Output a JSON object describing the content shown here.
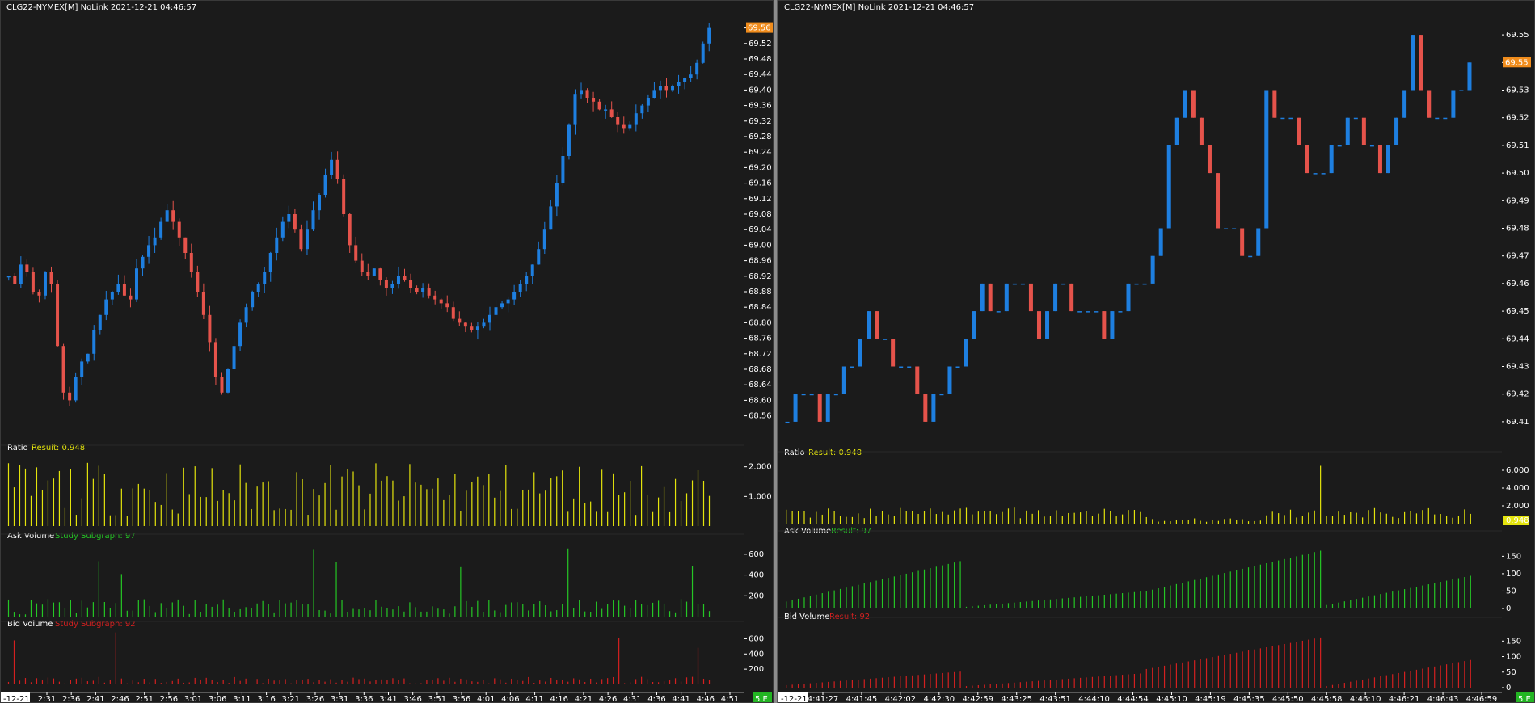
{
  "colors": {
    "background": "#1b1b1b",
    "up_bar": "#1e7fe0",
    "down_bar": "#e5534b",
    "ratio": "#e4e40c",
    "ask": "#25c725",
    "bid": "#d42020",
    "last_price_bg": "#f08c1c",
    "separator": "#9a9a9a",
    "accent_green": "#23b523"
  },
  "left": {
    "title": "CLG22-NYMEX[M] NoLink 2021-12-21 04:46:57",
    "last_price_label": "69.56",
    "studies": {
      "ratio": {
        "name": "Ratio",
        "result": "Result: 0.948"
      },
      "ask": {
        "name": "Ask Volume",
        "result": "Study Subgraph: 97"
      },
      "bid": {
        "name": "Bid Volume",
        "result": "Study Subgraph: 92"
      }
    },
    "date_label": "-12-21",
    "corner_badge": "5 E"
  },
  "right": {
    "title": "CLG22-NYMEX[M] NoLink 2021-12-21 04:46:57",
    "last_price_label": "69.55",
    "ratio_last_label": "0.948",
    "studies": {
      "ratio": {
        "name": "Ratio",
        "result": "Result: 0.948"
      },
      "ask": {
        "name": "Ask Volume",
        "result": "Result: 97"
      },
      "bid": {
        "name": "Bid Volume",
        "result": "Result: 92"
      }
    },
    "date_label": "-12-21",
    "corner_badge": "5 E"
  },
  "chart_data": [
    {
      "type": "candlestick",
      "title": "CLG22-NYMEX[M] NoLink 2021-12-21 04:46:57",
      "ylim": [
        68.53,
        69.58
      ],
      "y_ticks": [
        "69.56",
        "69.52",
        "69.48",
        "69.44",
        "69.40",
        "69.36",
        "69.32",
        "69.28",
        "69.24",
        "69.20",
        "69.16",
        "69.12",
        "69.08",
        "69.04",
        "69.00",
        "68.96",
        "68.92",
        "68.88",
        "68.84",
        "68.80",
        "68.76",
        "68.72",
        "68.68",
        "68.64",
        "68.60",
        "68.56"
      ],
      "x_ticks": [
        "2:31",
        "2:36",
        "2:41",
        "2:46",
        "2:51",
        "2:56",
        "3:01",
        "3:06",
        "3:11",
        "3:16",
        "3:21",
        "3:26",
        "3:31",
        "3:36",
        "3:41",
        "3:46",
        "3:51",
        "3:56",
        "4:01",
        "4:06",
        "4:11",
        "4:16",
        "4:21",
        "4:26",
        "4:31",
        "4:36",
        "4:41",
        "4:46",
        "4:51"
      ],
      "close_path": [
        68.92,
        68.9,
        68.95,
        68.93,
        68.88,
        68.87,
        68.93,
        68.9,
        68.74,
        68.62,
        68.6,
        68.66,
        68.7,
        68.72,
        68.78,
        68.82,
        68.86,
        68.88,
        68.9,
        68.87,
        68.86,
        68.94,
        68.97,
        69.0,
        69.02,
        69.06,
        69.09,
        69.06,
        69.02,
        68.98,
        68.93,
        68.88,
        68.82,
        68.75,
        68.66,
        68.62,
        68.68,
        68.74,
        68.8,
        68.84,
        68.88,
        68.9,
        68.93,
        68.98,
        69.02,
        69.06,
        69.08,
        69.04,
        68.99,
        69.04,
        69.09,
        69.13,
        69.18,
        69.22,
        69.17,
        69.08,
        69.0,
        68.96,
        68.93,
        68.92,
        68.94,
        68.91,
        68.89,
        68.9,
        68.92,
        68.91,
        68.89,
        68.88,
        68.89,
        68.87,
        68.86,
        68.85,
        68.84,
        68.81,
        68.8,
        68.79,
        68.78,
        68.79,
        68.8,
        68.82,
        68.84,
        68.85,
        68.86,
        68.88,
        68.9,
        68.92,
        68.95,
        68.99,
        69.04,
        69.1,
        69.16,
        69.23,
        69.31,
        69.39,
        69.4,
        69.38,
        69.37,
        69.35,
        69.35,
        69.33,
        69.31,
        69.3,
        69.31,
        69.34,
        69.36,
        69.38,
        69.4,
        69.41,
        69.4,
        69.41,
        69.42,
        69.43,
        69.44,
        69.47,
        69.52,
        69.56
      ],
      "ratio": {
        "ylim": [
          0,
          2.4
        ],
        "y_ticks": [
          "2.000",
          "1.000"
        ]
      },
      "ask_volume": {
        "ylim": [
          0,
          700
        ],
        "y_ticks": [
          "600",
          "400",
          "200"
        ]
      },
      "bid_volume": {
        "ylim": [
          0,
          700
        ],
        "y_ticks": [
          "600",
          "400",
          "200"
        ]
      }
    },
    {
      "type": "candlestick",
      "title": "CLG22-NYMEX[M] NoLink 2021-12-21 04:46:57",
      "ylim": [
        69.405,
        69.555
      ],
      "y_ticks": [
        "69.55",
        "69.54",
        "69.53",
        "69.52",
        "69.51",
        "69.50",
        "69.49",
        "69.48",
        "69.47",
        "69.46",
        "69.45",
        "69.44",
        "69.43",
        "69.42",
        "69.41"
      ],
      "x_ticks": [
        "4:41:27",
        "4:41:45",
        "4:42:02",
        "4:42:30",
        "4:42:59",
        "4:43:25",
        "4:43:51",
        "4:44:10",
        "4:44:54",
        "4:45:10",
        "4:45:19",
        "4:45:35",
        "4:45:50",
        "4:45:58",
        "4:46:10",
        "4:46:21",
        "4:46:43",
        "4:46:59"
      ],
      "close_path": [
        69.41,
        69.42,
        69.42,
        69.42,
        69.41,
        69.42,
        69.42,
        69.43,
        69.43,
        69.44,
        69.45,
        69.44,
        69.44,
        69.43,
        69.43,
        69.43,
        69.42,
        69.41,
        69.42,
        69.42,
        69.43,
        69.43,
        69.44,
        69.45,
        69.46,
        69.45,
        69.45,
        69.46,
        69.46,
        69.46,
        69.45,
        69.44,
        69.45,
        69.46,
        69.46,
        69.45,
        69.45,
        69.45,
        69.45,
        69.44,
        69.45,
        69.45,
        69.46,
        69.46,
        69.46,
        69.47,
        69.48,
        69.51,
        69.52,
        69.53,
        69.52,
        69.51,
        69.5,
        69.48,
        69.48,
        69.48,
        69.47,
        69.47,
        69.48,
        69.53,
        69.52,
        69.52,
        69.52,
        69.51,
        69.5,
        69.5,
        69.5,
        69.51,
        69.51,
        69.52,
        69.52,
        69.51,
        69.51,
        69.5,
        69.51,
        69.52,
        69.53,
        69.55,
        69.53,
        69.52,
        69.52,
        69.52,
        69.53,
        69.53,
        69.54
      ],
      "ratio": {
        "ylim": [
          0,
          7
        ],
        "y_ticks": [
          "6.000",
          "4.000",
          "2.000"
        ]
      },
      "ask_volume": {
        "ylim": [
          0,
          195
        ],
        "y_ticks": [
          "150",
          "100",
          "50",
          "0"
        ]
      },
      "bid_volume": {
        "ylim": [
          0,
          195
        ],
        "y_ticks": [
          "150",
          "100",
          "50",
          "0"
        ]
      }
    }
  ]
}
